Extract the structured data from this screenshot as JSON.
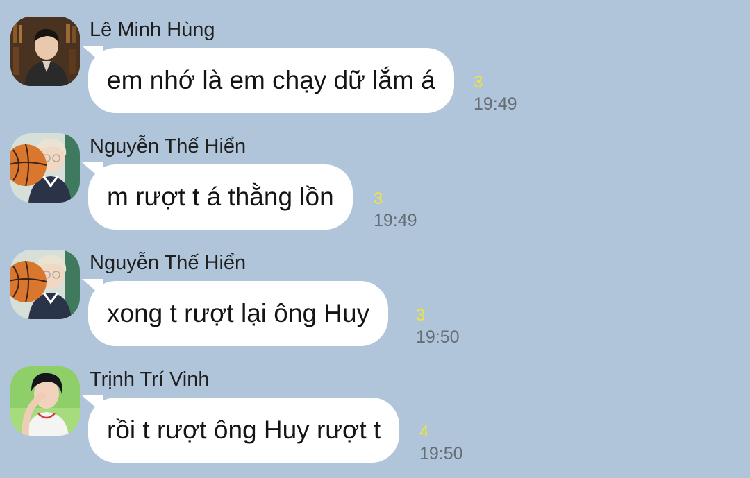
{
  "messages": [
    {
      "sender": "Lê Minh Hùng",
      "text": "em nhớ là em chạy dữ lắm á",
      "unread": "3",
      "time": "19:49",
      "avatar": "avatar-young-man-bookshelf"
    },
    {
      "sender": "Nguyễn Thế Hiển",
      "text": "m rượt t á thằng lồn",
      "unread": "3",
      "time": "19:49",
      "avatar": "avatar-boy-basketball"
    },
    {
      "sender": "Nguyễn Thế Hiển",
      "text": "xong t rượt lại ông Huy",
      "unread": "3",
      "time": "19:50",
      "avatar": "avatar-boy-basketball"
    },
    {
      "sender": "Trịnh Trí Vinh",
      "text": "rồi t rượt ông Huy rượt t",
      "unread": "4",
      "time": "19:50",
      "avatar": "avatar-boy-green-background"
    }
  ],
  "colors": {
    "background": "#b0c5da",
    "bubble": "#ffffff",
    "unread": "#f3e533",
    "time": "#666d75"
  }
}
